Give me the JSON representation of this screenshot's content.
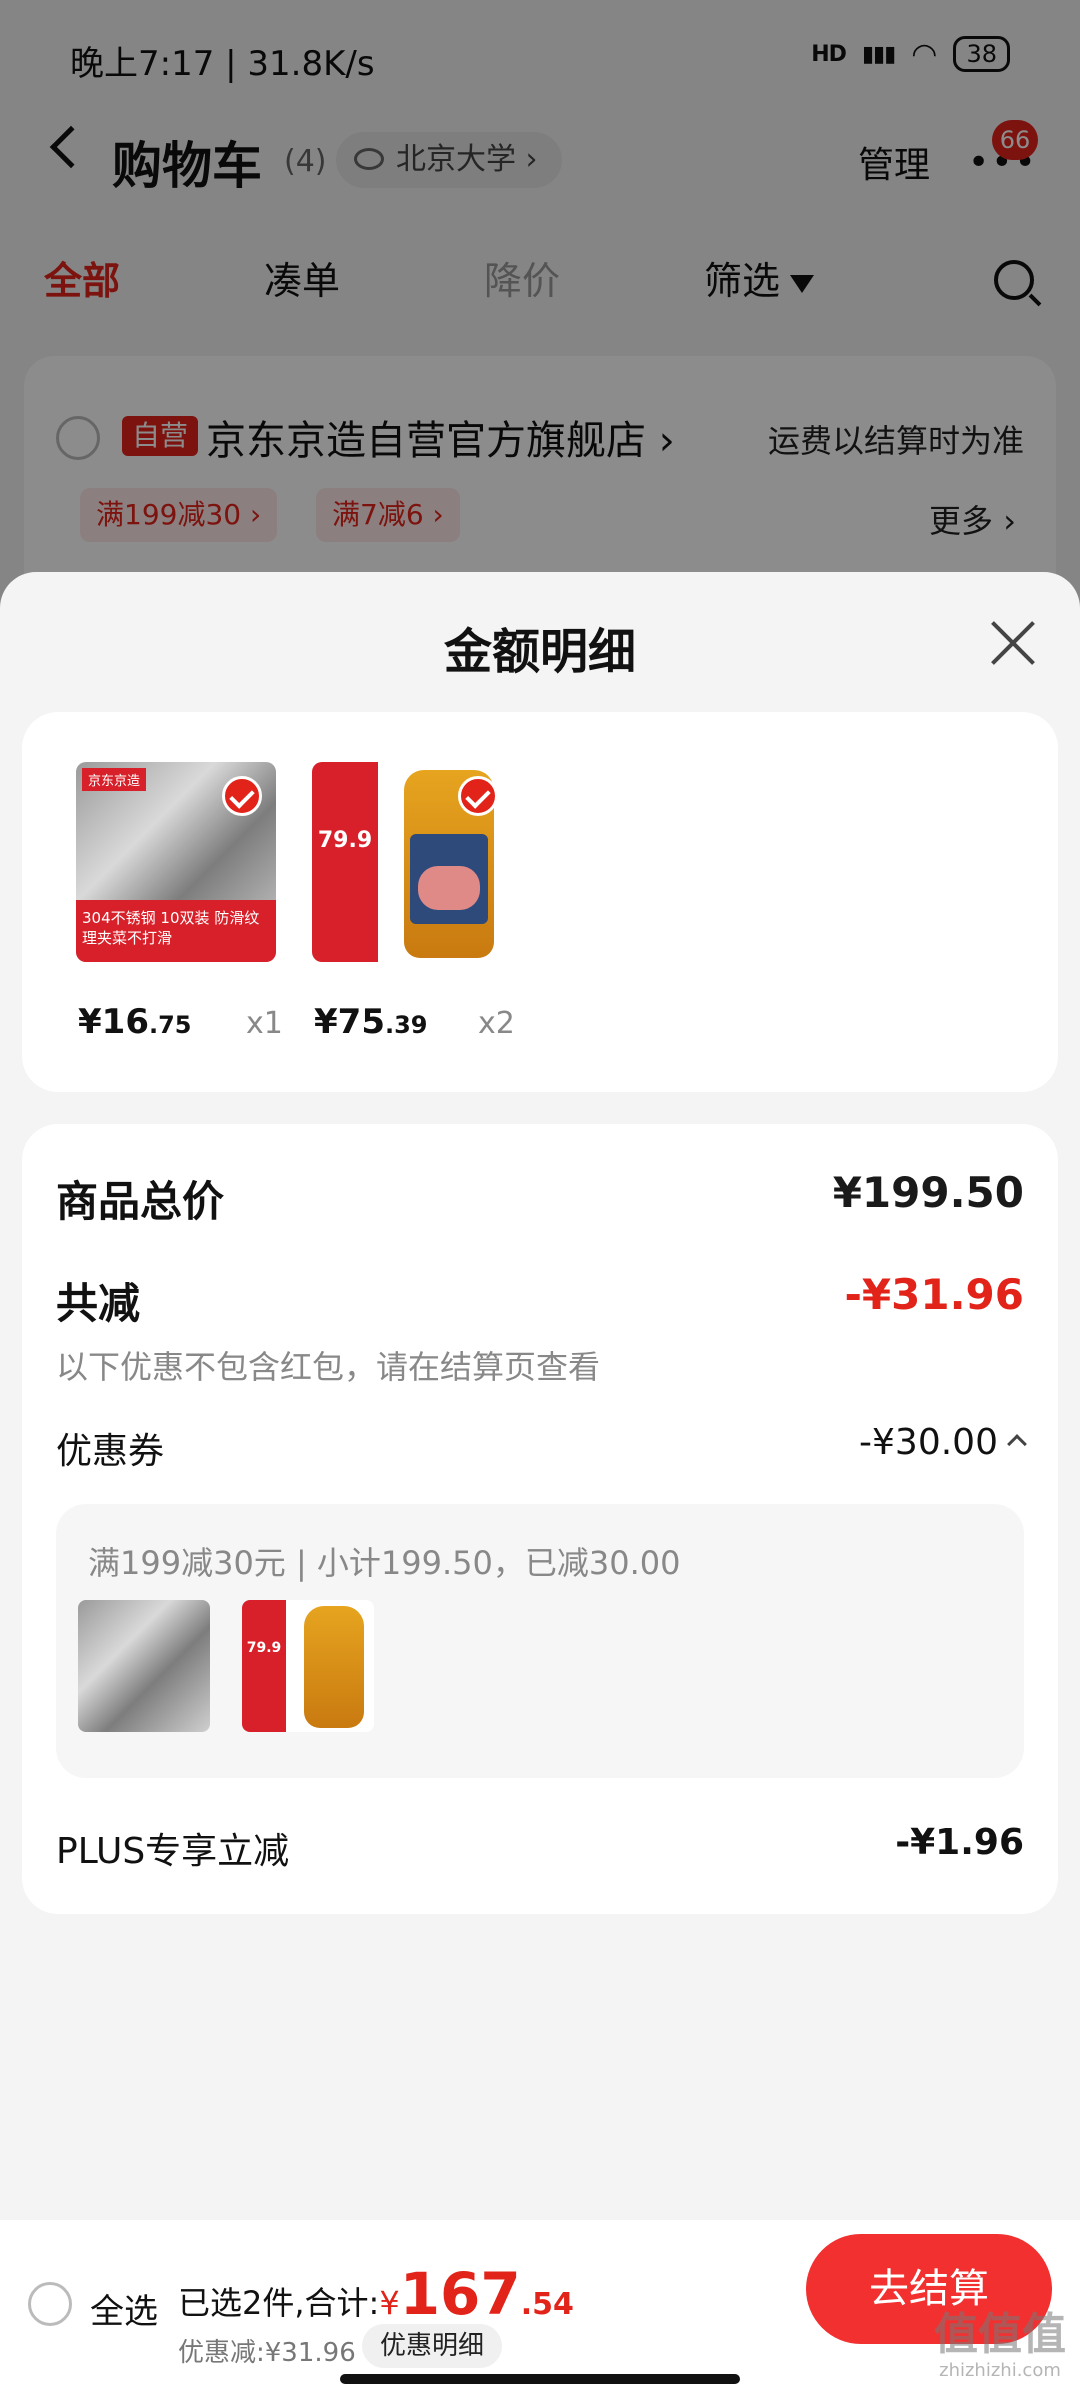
{
  "status_bar": {
    "time": "晚上7:17 | 31.8K/s",
    "battery": "38",
    "network": "HD"
  },
  "header": {
    "title": "购物车",
    "count": "(4)",
    "location": "北京大学",
    "manage": "管理",
    "more": "•••",
    "badge": "66"
  },
  "tabs": [
    {
      "label": "全部",
      "state": "active"
    },
    {
      "label": "凑单",
      "state": "normal"
    },
    {
      "label": "降价",
      "state": "muted"
    },
    {
      "label": "筛选",
      "state": "normal"
    }
  ],
  "store": {
    "tag": "自营",
    "name": "京东京造自营官方旗舰店 ›",
    "shipping_note": "运费以结算时为准",
    "promos": [
      "满199减30 ›",
      "满7减6 ›"
    ],
    "more": "更多 ›"
  },
  "sheet": {
    "title": "金额明细",
    "items": [
      {
        "name": "chopsticks",
        "thumb_brand": "京东京造",
        "thumb_text": "304不锈钢 10双装 防滑纹理夹菜不打滑",
        "price_main": "¥16",
        "price_cents": ".75",
        "qty": "x1"
      },
      {
        "name": "peanut-oil",
        "thumb_text": "79.9",
        "price_main": "¥75",
        "price_cents": ".39",
        "qty": "x2"
      }
    ],
    "breakdown": {
      "goods_total_label": "商品总价",
      "goods_total_value": "¥199.50",
      "total_discount_label": "共减",
      "total_discount_value": "-¥31.96",
      "note": "以下优惠不包含红包，请在结算页查看",
      "coupon_label": "优惠券",
      "coupon_value": "-¥30.00",
      "coupon_detail": "满199减30元 | 小计199.50，已减30.00",
      "plus_label": "PLUS专享立减",
      "plus_value": "-¥1.96"
    }
  },
  "bottom_bar": {
    "select_all": "全选",
    "summary_prefix": "已选2件,合计:",
    "yen": "¥",
    "total_main": "167",
    "total_cents": ".54",
    "discount": "优惠减:¥31.96",
    "detail_button": "优惠明细",
    "checkout": "去结算"
  },
  "watermark": {
    "text": "值值值",
    "sub": "zhizhizhi.com"
  },
  "colors": {
    "accent": "#e2231a",
    "checkout": "#f23030"
  }
}
